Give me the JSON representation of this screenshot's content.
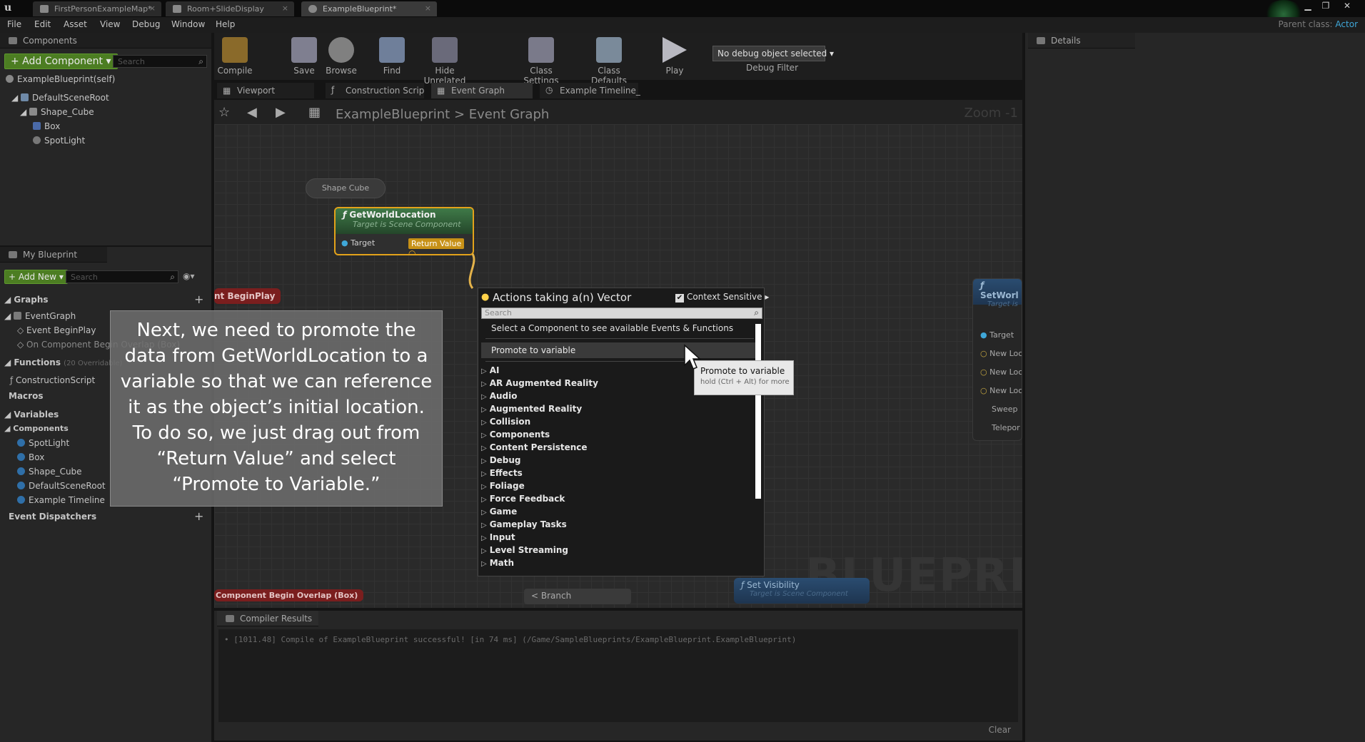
{
  "tabs": [
    {
      "label": "FirstPersonExampleMap*"
    },
    {
      "label": "Room+SlideDisplay"
    },
    {
      "label": "ExampleBlueprint*"
    }
  ],
  "menu": [
    "File",
    "Edit",
    "Asset",
    "View",
    "Debug",
    "Window",
    "Help"
  ],
  "parent_class": {
    "label": "Parent class:",
    "value": "Actor"
  },
  "components": {
    "title": "Components",
    "add_label": "+ Add Component ▾",
    "search_placeholder": "Search",
    "self_label": "ExampleBlueprint(self)",
    "tree": [
      {
        "label": "DefaultSceneRoot"
      },
      {
        "label": "Shape_Cube"
      },
      {
        "label": "Box"
      },
      {
        "label": "SpotLight"
      }
    ]
  },
  "my_blueprint": {
    "title": "My Blueprint",
    "add_new_label": "+ Add New ▾",
    "search_placeholder": "Search",
    "graphs_label": "Graphs",
    "eventgraph": "EventGraph",
    "event_beginplay": "Event BeginPlay",
    "on_component": "On Component Begin Overlap (Box)",
    "functions_label": "Functions",
    "functions_count": "(20 Overridable)",
    "construction": "ConstructionScript",
    "macros_label": "Macros",
    "variables_label": "Variables",
    "components_label": "Components",
    "comp_items": [
      {
        "label": "SpotLight"
      },
      {
        "label": "Box"
      },
      {
        "label": "Shape_Cube"
      },
      {
        "label": "DefaultSceneRoot"
      },
      {
        "label": "Example Timeline"
      }
    ],
    "dispatchers_label": "Event Dispatchers"
  },
  "toolbar": {
    "compile": "Compile",
    "save": "Save",
    "browse": "Browse",
    "find": "Find",
    "hide_unrelated": "Hide Unrelated",
    "class_settings": "Class Settings",
    "class_defaults": "Class Defaults",
    "play": "Play",
    "debug_select": "No debug object selected ▾",
    "debug_filter": "Debug Filter"
  },
  "doc_tabs": [
    {
      "label": "Viewport"
    },
    {
      "label": "Construction Scrip"
    },
    {
      "label": "Event Graph"
    },
    {
      "label": "Example Timeline_"
    }
  ],
  "breadcrumb": {
    "blueprint": "ExampleBlueprint",
    "sep": ">",
    "graph": "Event Graph"
  },
  "zoom": "Zoom -1",
  "nodes": {
    "shape_cube": "Shape Cube",
    "gwl_title": "GetWorldLocation",
    "gwl_sub": "Target is Scene Component",
    "target": "Target",
    "return_value": "Return Value",
    "begin_play": "nt BeginPlay",
    "overlap": "Component Begin Overlap (Box)",
    "branch": "Branch",
    "set_visibility": "Set Visibility",
    "set_vis_sub": "Target is Scene Component",
    "setworld": "SetWorl",
    "setworld_sub": "Target is",
    "right_pins": [
      {
        "label": "Target"
      },
      {
        "label": "New Loc"
      },
      {
        "label": "New Loc"
      },
      {
        "label": "New Loc"
      },
      {
        "label": "Sweep"
      },
      {
        "label": "Telepor"
      }
    ]
  },
  "context_menu": {
    "title": "Actions taking a(n) Vector",
    "context_sensitive": "Context Sensitive",
    "search_placeholder": "Search",
    "hint": "Select a Component to see available Events & Functions",
    "promote": "Promote to variable",
    "categories": [
      {
        "label": "AI"
      },
      {
        "label": "AR Augmented Reality"
      },
      {
        "label": "Audio"
      },
      {
        "label": "Augmented Reality"
      },
      {
        "label": "Collision"
      },
      {
        "label": "Components"
      },
      {
        "label": "Content Persistence"
      },
      {
        "label": "Debug"
      },
      {
        "label": "Effects"
      },
      {
        "label": "Foliage"
      },
      {
        "label": "Force Feedback"
      },
      {
        "label": "Game"
      },
      {
        "label": "Gameplay Tasks"
      },
      {
        "label": "Input"
      },
      {
        "label": "Level Streaming"
      },
      {
        "label": "Math"
      }
    ]
  },
  "tooltip": {
    "title": "Promote to variable",
    "hint": "hold (Ctrl + Alt) for more"
  },
  "overlay_text": "Next, we need to promote the data from GetWorldLocation to a variable so that we can reference it as the object’s initial location. To do so, we just drag out from “Return Value” and select “Promote to Variable.”",
  "watermark": "BLUEPRINT",
  "compiler": {
    "title": "Compiler Results",
    "log": "• [1011.48] Compile of ExampleBlueprint successful! [in 74 ms] (/Game/SampleBlueprints/ExampleBlueprint.ExampleBlueprint)",
    "clear": "Clear"
  },
  "details": {
    "title": "Details"
  }
}
